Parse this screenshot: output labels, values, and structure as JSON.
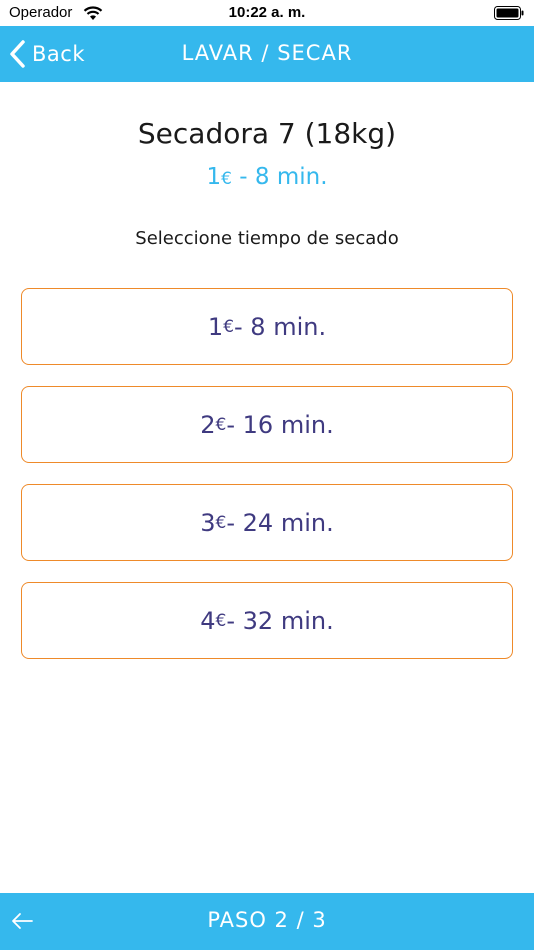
{
  "status_bar": {
    "carrier": "Operador",
    "time": "10:22 a. m."
  },
  "nav": {
    "back_label": "Back",
    "title": "LAVAR / SECAR"
  },
  "machine": {
    "title": "Secadora 7 (18kg)",
    "selected": {
      "price": "1",
      "currency": "€",
      "duration": " - 8 min."
    }
  },
  "instruction": "Seleccione tiempo de secado",
  "options": [
    {
      "price": "1",
      "currency": "€",
      "duration": " - 8 min."
    },
    {
      "price": "2",
      "currency": "€",
      "duration": " - 16 min."
    },
    {
      "price": "3",
      "currency": "€",
      "duration": " - 24 min."
    },
    {
      "price": "4",
      "currency": "€",
      "duration": " - 32 min."
    }
  ],
  "footer": {
    "step": "PASO 2 / 3"
  },
  "colors": {
    "accent": "#35b8ed",
    "option_border": "#ee8a2a",
    "option_text": "#3f3a80"
  }
}
